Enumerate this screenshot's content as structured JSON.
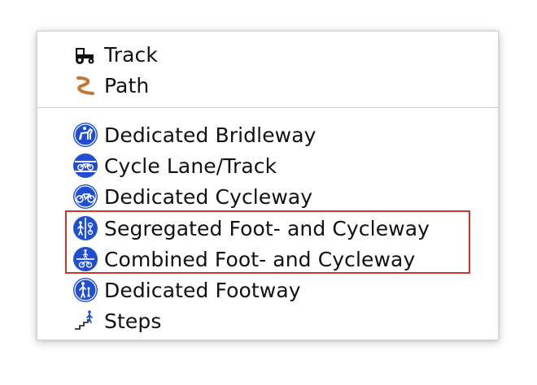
{
  "menu": {
    "items": [
      {
        "label": "Track",
        "icon": "tractor-icon"
      },
      {
        "label": "Path",
        "icon": "path-icon"
      },
      {
        "label": "Dedicated Bridleway",
        "icon": "bridleway-sign-icon"
      },
      {
        "label": "Cycle Lane/Track",
        "icon": "cycle-lane-sign-icon"
      },
      {
        "label": "Dedicated Cycleway",
        "icon": "cycleway-sign-icon"
      },
      {
        "label": "Segregated Foot- and Cycleway",
        "icon": "segregated-foot-cycleway-sign-icon"
      },
      {
        "label": "Combined Foot- and Cycleway",
        "icon": "combined-foot-cycleway-sign-icon"
      },
      {
        "label": "Dedicated Footway",
        "icon": "footway-sign-icon"
      },
      {
        "label": "Steps",
        "icon": "steps-icon"
      }
    ]
  },
  "colors": {
    "sign_blue": "#1f4fd0",
    "path_brown": "#c8762f",
    "highlight_red": "#d0352a"
  }
}
